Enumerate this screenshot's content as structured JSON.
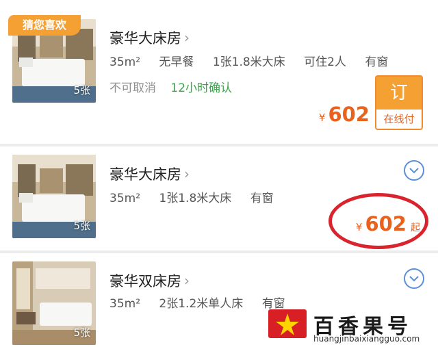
{
  "rooms": [
    {
      "badge": "猜您喜欢",
      "name": "豪华大床房",
      "photo_count": "5张",
      "specs": [
        "35m²",
        "无早餐",
        "1张1.8米大床",
        "可住2人",
        "有窗"
      ],
      "cancel_policy": "不可取消",
      "confirm_policy": "12小时确认",
      "currency": "¥",
      "price": "602",
      "book_button": {
        "top": "订",
        "bottom": "在线付"
      }
    },
    {
      "name": "豪华大床房",
      "photo_count": "5张",
      "specs": [
        "35m²",
        "1张1.8米大床",
        "有窗"
      ],
      "currency": "¥",
      "price": "602",
      "price_suffix": "起"
    },
    {
      "name": "豪华双床房",
      "photo_count": "5张",
      "specs": [
        "35m²",
        "2张1.2米单人床",
        "有窗"
      ]
    }
  ],
  "watermark": {
    "title": "百香果号",
    "url": "huangjinbaixiangguo.com"
  },
  "colors": {
    "price": "#e8621e",
    "badge": "#f4a033",
    "confirm": "#3fa34d",
    "expand": "#5b8fd8",
    "annotation": "#d9232d"
  }
}
